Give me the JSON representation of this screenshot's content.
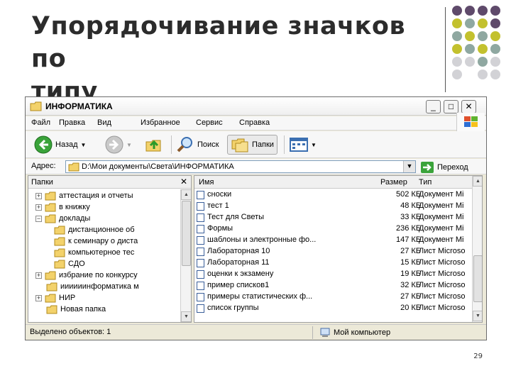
{
  "slide": {
    "title_line1": "Упорядочивание значков по",
    "title_line2": "типу",
    "page_number": "29"
  },
  "colors": {
    "dot_purple": "#5f4a6b",
    "dot_olive": "#c3c12e",
    "dot_teal": "#8fa8a1",
    "dot_gray": "#d2d2d6",
    "xp_blue_icon": "#3d6bc7",
    "folder_yellow": "#f3d26b"
  },
  "window": {
    "title": "ИНФОРМАТИКА",
    "buttons": {
      "minimize": "_",
      "maximize": "□",
      "close": "✕"
    }
  },
  "menu": [
    "Файл",
    "Правка",
    "Вид",
    "Избранное",
    "Сервис",
    "Справка"
  ],
  "toolbar": {
    "back_label": "Назад",
    "search_label": "Поиск",
    "folders_label": "Папки",
    "icons": [
      "back-arrow-icon",
      "forward-arrow-icon",
      "up-folder-icon",
      "search-icon",
      "folders-icon",
      "views-icon"
    ]
  },
  "address": {
    "label": "Адрес:",
    "path": "D:\\Мои документы\\Света\\ИНФОРМАТИКА",
    "go_label": "Переход"
  },
  "folders_pane": {
    "title": "Папки",
    "close": "✕",
    "items": [
      {
        "label": "аттестация и отчеты",
        "level": 0,
        "expander": "+"
      },
      {
        "label": "в книжку",
        "level": 0,
        "expander": "+"
      },
      {
        "label": "доклады",
        "level": 0,
        "expander": "−"
      },
      {
        "label": "дистанционное об",
        "level": 1,
        "expander": ""
      },
      {
        "label": "к семинару о диста",
        "level": 1,
        "expander": ""
      },
      {
        "label": "компьютерное тес",
        "level": 1,
        "expander": ""
      },
      {
        "label": "СДО",
        "level": 1,
        "expander": ""
      },
      {
        "label": "избрание по конкурсу",
        "level": 0,
        "expander": "+"
      },
      {
        "label": "иииииинформатика м",
        "level": 0,
        "expander": ""
      },
      {
        "label": "НИР",
        "level": 0,
        "expander": "+"
      },
      {
        "label": "Новая папка",
        "level": 0,
        "expander": ""
      }
    ]
  },
  "files_pane": {
    "columns": {
      "name": "Имя",
      "size": "Размер",
      "type": "Тип"
    },
    "rows": [
      {
        "name": "сноски",
        "size": "502 КБ",
        "type": "Документ Mi"
      },
      {
        "name": "тест 1",
        "size": "48 КБ",
        "type": "Документ Mi"
      },
      {
        "name": "Тест для Светы",
        "size": "33 КБ",
        "type": "Документ Mi"
      },
      {
        "name": "Формы",
        "size": "236 КБ",
        "type": "Документ Mi"
      },
      {
        "name": "шаблоны и электронные фо...",
        "size": "147 КБ",
        "type": "Документ Mi"
      },
      {
        "name": "Лабораторная 10",
        "size": "27 КБ",
        "type": "Лист Microso"
      },
      {
        "name": "Лабораторная 11",
        "size": "15 КБ",
        "type": "Лист Microso"
      },
      {
        "name": "оценки к экзамену",
        "size": "19 КБ",
        "type": "Лист Microso"
      },
      {
        "name": "пример списков1",
        "size": "32 КБ",
        "type": "Лист Microso"
      },
      {
        "name": "примеры статистических ф...",
        "size": "27 КБ",
        "type": "Лист Microso"
      },
      {
        "name": "список группы",
        "size": "20 КБ",
        "type": "Лист Microso"
      }
    ]
  },
  "status": {
    "selected": "Выделено объектов: 1",
    "location": "Мой компьютер"
  }
}
